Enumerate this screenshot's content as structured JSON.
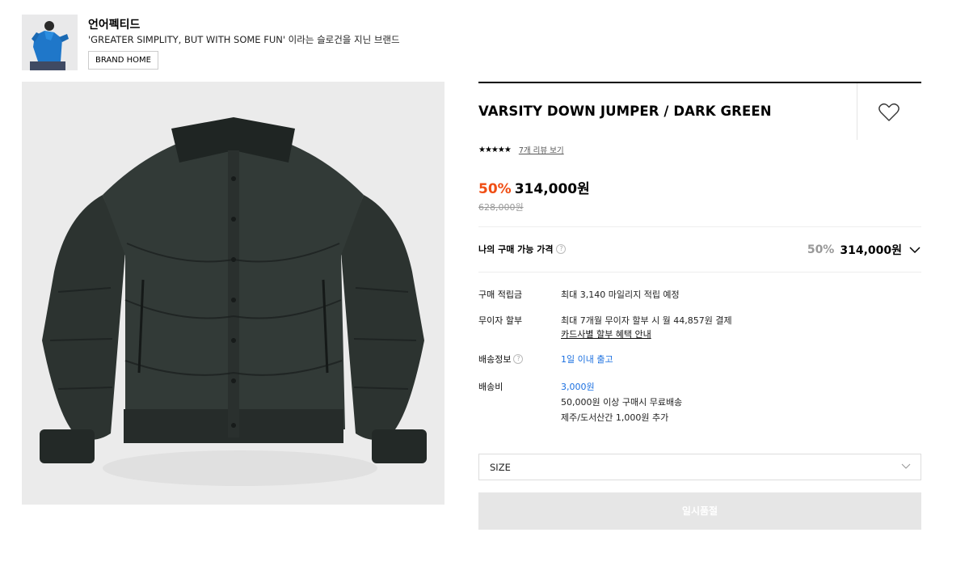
{
  "brand": {
    "name": "언어펙티드",
    "slogan": "'GREATER SIMPLITY, BUT WITH SOME FUN' 이라는 슬로건을 지닌 브랜드",
    "home_label": "BRAND HOME"
  },
  "product": {
    "title": "VARSITY DOWN JUMPER / DARK GREEN",
    "stars": "★★★★★",
    "review_link": "7개 리뷰 보기",
    "discount": "50%",
    "price": "314,000원",
    "original_price": "628,000원"
  },
  "my_price": {
    "label": "나의 구매 가능 가격",
    "help": "?",
    "discount": "50%",
    "price": "314,000원"
  },
  "info": {
    "points_label": "구매 적립금",
    "points_value": "최대 3,140 마일리지 적립 예정",
    "installment_label": "무이자 할부",
    "installment_value": "최대 7개월 무이자 할부 시 월 44,857원 결제",
    "installment_link": "카드사별 할부 혜택 안내",
    "delivery_label": "배송정보",
    "delivery_value": "1일 이내 출고",
    "fee_label": "배송비",
    "fee_value": "3,000원",
    "fee_free": "50,000원 이상 구매시 무료배송",
    "fee_extra": "제주/도서산간 1,000원 추가"
  },
  "options": {
    "size_label": "SIZE"
  },
  "actions": {
    "soldout_label": "일시품절"
  },
  "colors": {
    "discount": "#f04e14",
    "link_blue": "#1a6fe0"
  }
}
